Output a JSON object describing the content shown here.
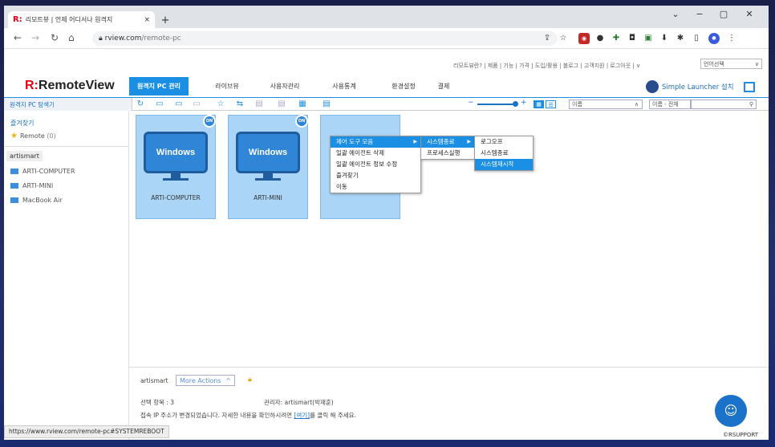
{
  "browser": {
    "tab_favicon": "R:",
    "tab_title": "리모트뷰 | 언제 어디서나 원격지",
    "tab_close": "×",
    "new_tab": "+",
    "min": "−",
    "max": "▢",
    "close": "✕",
    "chev": "⌄",
    "url_host": "rview.com",
    "url_path": "/remote-pc"
  },
  "site": {
    "logo_mark": "R:",
    "logo_text": "RemoteView",
    "top_menu": "리모트뷰란? | 제품 | 기능 | 가격 | 도입/활용 | 블로그 | 고객지원 | 로그아웃 | ∨",
    "lang_select": "언어선택",
    "nav": [
      "원격지 PC 관리",
      "라이브뷰",
      "사용자관리",
      "사용통계",
      "환경설정",
      "결제"
    ],
    "simple_launcher": "Simple Launcher 설치"
  },
  "toolbar": {
    "explorer_label": "원격지 PC 탐색기",
    "sort_select": "이름",
    "search_scope": "이름 - 전체",
    "search_placeholder": ""
  },
  "sidebar": {
    "favorites_label": "즐겨찾기",
    "favorite_item": "Remote",
    "favorite_count": "(0)",
    "user": "artismart",
    "pcs": [
      "ARTI-COMPUTER",
      "ARTI-MINI",
      "MacBook Air"
    ]
  },
  "cards": [
    {
      "os": "Windows",
      "status": "ON",
      "name": "ARTI-COMPUTER"
    },
    {
      "os": "Windows",
      "status": "ON",
      "name": "ARTI-MINI"
    }
  ],
  "context_menu": {
    "main": [
      "제어 도구 모음",
      "일괄 에이전트 삭제",
      "일괄 에이전트 정보 수정",
      "즐겨찾기",
      "이동"
    ],
    "sub1": [
      "시스템종료",
      "프로세스실행"
    ],
    "sub2": [
      "로그오프",
      "시스템종료",
      "시스템재시작"
    ]
  },
  "footer": {
    "user": "artismart",
    "more_actions": "More Actions",
    "more_caret": "^",
    "selected": "선택 항목 : 3",
    "admin": "관리자: artismart(박재훈)",
    "notice_pre": "접속 IP 주소가 변경되었습니다. 자세한 내용을 확인하시려면 ",
    "notice_link": "[여기]",
    "notice_post": "를 클릭 해 주세요.",
    "copyright": "©RSUPPORT"
  },
  "status_url": "https://www.rview.com/remote-pc#SYSTEMREBOOT",
  "colors": {
    "accent": "#1a8fe3",
    "brand_red": "#e60012",
    "card_bg": "#abd5f7"
  }
}
